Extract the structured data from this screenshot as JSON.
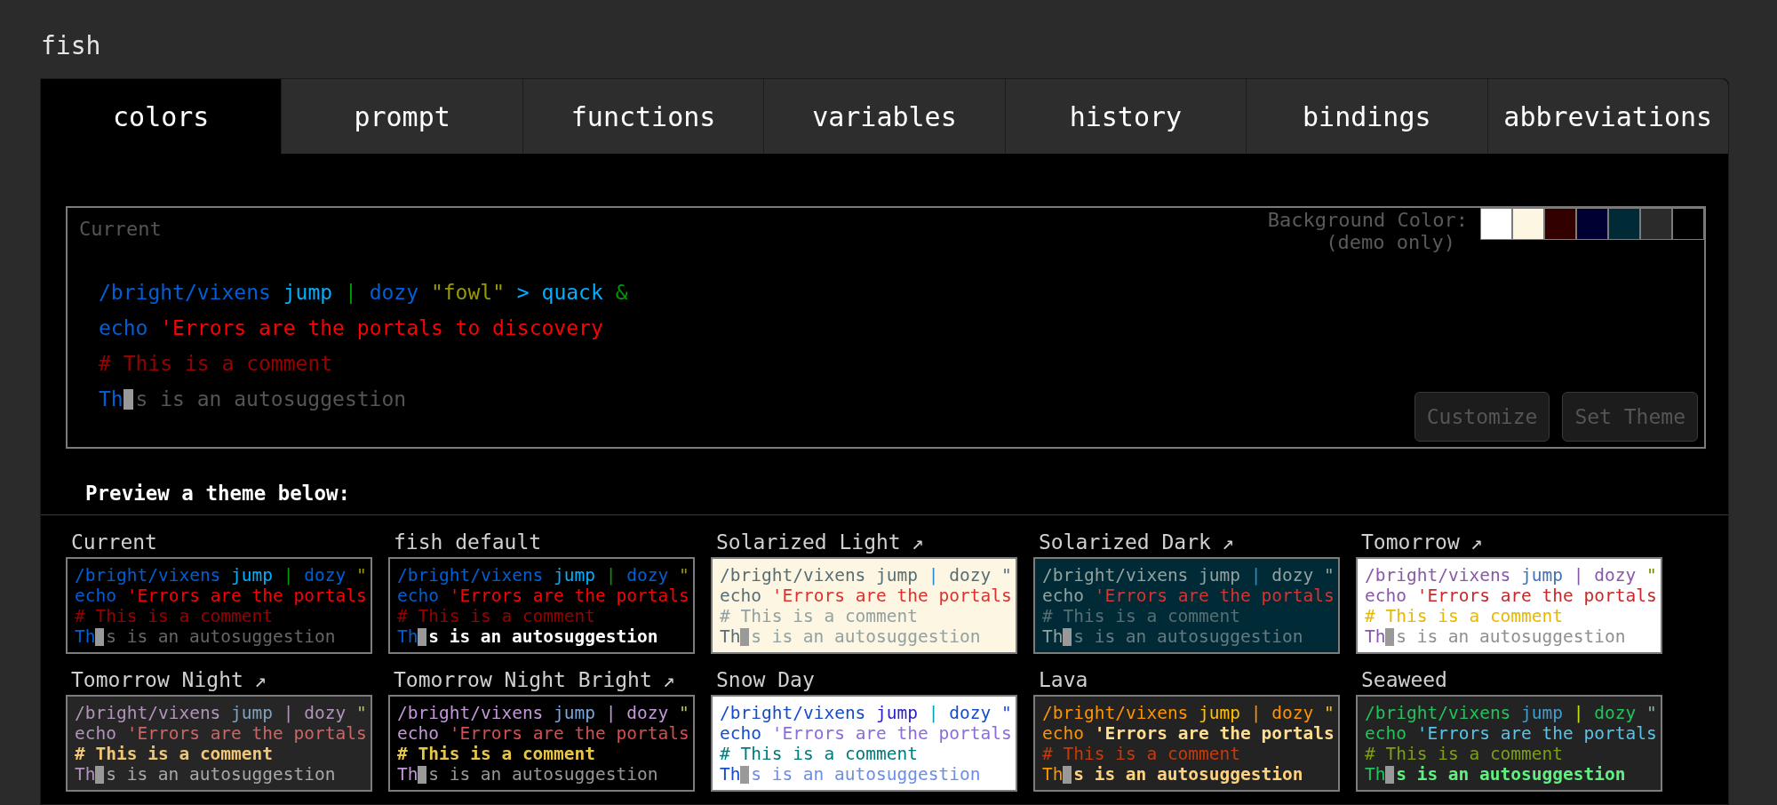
{
  "app": {
    "title": "fish"
  },
  "tabs": [
    {
      "label": "colors",
      "selected": true
    },
    {
      "label": "prompt",
      "selected": false
    },
    {
      "label": "functions",
      "selected": false
    },
    {
      "label": "variables",
      "selected": false
    },
    {
      "label": "history",
      "selected": false
    },
    {
      "label": "bindings",
      "selected": false
    },
    {
      "label": "abbreviations",
      "selected": false
    }
  ],
  "current_preview": {
    "label": "Current",
    "background_picker": {
      "label": "Background Color:",
      "note": "(demo only)",
      "swatches": [
        {
          "color": "#ffffff"
        },
        {
          "color": "#fdf6e3"
        },
        {
          "color": "#330000"
        },
        {
          "color": "#000033"
        },
        {
          "color": "#002b36"
        },
        {
          "color": "#2b2b2b"
        },
        {
          "color": "#000000"
        }
      ]
    },
    "lines": [
      [
        {
          "kind": "plain",
          "text": "/bright/vixens",
          "color": "#005fd7"
        },
        {
          "kind": "plain",
          "text": " jump",
          "color": "#00afff"
        },
        {
          "kind": "plain",
          "text": " |",
          "color": "#009900"
        },
        {
          "kind": "plain",
          "text": " dozy",
          "color": "#005fd7"
        },
        {
          "kind": "plain",
          "text": " \"fowl\"",
          "color": "#999900"
        },
        {
          "kind": "plain",
          "text": " >",
          "color": "#00afff"
        },
        {
          "kind": "plain",
          "text": " quack",
          "color": "#00afff"
        },
        {
          "kind": "plain",
          "text": " &",
          "color": "#009900"
        }
      ],
      [
        {
          "kind": "plain",
          "text": "echo",
          "color": "#005fd7"
        },
        {
          "kind": "plain",
          "text": " 'Errors are the portals to discovery",
          "color": "#ff0000"
        }
      ],
      [
        {
          "kind": "plain",
          "text": "# This is a comment",
          "color": "#990000"
        }
      ],
      [
        {
          "kind": "plain",
          "text": "Th",
          "color": "#005fd7"
        },
        {
          "kind": "cursor"
        },
        {
          "kind": "plain",
          "text": "s is an autosuggestion",
          "color": "#555555"
        }
      ]
    ],
    "buttons": [
      {
        "label": "Customize",
        "disabled": true
      },
      {
        "label": "Set Theme",
        "disabled": true
      }
    ]
  },
  "themes_heading": "Preview a theme below:",
  "themes": [
    {
      "name": "Current",
      "color": "#000000",
      "lines": [
        [
          {
            "kind": "plain",
            "text": "/bright/vixens",
            "color": "#005fd7"
          },
          {
            "kind": "plain",
            "text": " jump",
            "color": "#00afff"
          },
          {
            "kind": "plain",
            "text": " |",
            "color": "#009900"
          },
          {
            "kind": "plain",
            "text": " dozy",
            "color": "#005fd7"
          },
          {
            "kind": "plain",
            "text": " \"",
            "color": "#999900"
          }
        ],
        [
          {
            "kind": "plain",
            "text": "echo",
            "color": "#005fd7"
          },
          {
            "kind": "plain",
            "text": " 'Errors are the portals",
            "color": "#ff0000"
          }
        ],
        [
          {
            "kind": "plain",
            "text": "# This is a comment",
            "color": "#990000"
          }
        ],
        [
          {
            "kind": "plain",
            "text": "Th",
            "color": "#005fd7"
          },
          {
            "kind": "cursor"
          },
          {
            "kind": "plain",
            "text": "s is an autosuggestion",
            "color": "#666666"
          }
        ]
      ]
    },
    {
      "name": "fish default",
      "color": "#000000",
      "lines": [
        [
          {
            "kind": "plain",
            "text": "/bright/vixens",
            "color": "#005fd7"
          },
          {
            "kind": "plain",
            "text": " jump",
            "color": "#00afff"
          },
          {
            "kind": "plain",
            "text": " |",
            "color": "#009900"
          },
          {
            "kind": "plain",
            "text": " dozy",
            "color": "#005fd7"
          },
          {
            "kind": "plain",
            "text": " \"",
            "color": "#999900"
          }
        ],
        [
          {
            "kind": "plain",
            "text": "echo",
            "color": "#005fd7"
          },
          {
            "kind": "plain",
            "text": " 'Errors are the portals",
            "color": "#ff0000"
          }
        ],
        [
          {
            "kind": "plain",
            "text": "# This is a comment",
            "color": "#990000"
          }
        ],
        [
          {
            "kind": "plain",
            "text": "Th",
            "color": "#005fd7"
          },
          {
            "kind": "cursor"
          },
          {
            "kind": "bold",
            "text": "s is an autosuggestion",
            "color": "#ffffff"
          }
        ]
      ]
    },
    {
      "name": "Solarized Light",
      "link": "↗",
      "color": "#fdf6e3",
      "lines": [
        [
          {
            "kind": "plain",
            "text": "/bright/vixens",
            "color": "#586e75"
          },
          {
            "kind": "plain",
            "text": " jump",
            "color": "#586e75"
          },
          {
            "kind": "plain",
            "text": " |",
            "color": "#268bd2"
          },
          {
            "kind": "plain",
            "text": " dozy",
            "color": "#586e75"
          },
          {
            "kind": "plain",
            "text": " \"",
            "color": "#586e75"
          }
        ],
        [
          {
            "kind": "plain",
            "text": "echo",
            "color": "#586e75"
          },
          {
            "kind": "plain",
            "text": " 'Errors are the portals",
            "color": "#dc322f"
          }
        ],
        [
          {
            "kind": "plain",
            "text": "# This is a comment",
            "color": "#93a1a1"
          }
        ],
        [
          {
            "kind": "plain",
            "text": "Th",
            "color": "#586e75"
          },
          {
            "kind": "cursor"
          },
          {
            "kind": "plain",
            "text": "s is an autosuggestion",
            "color": "#93a1a1"
          }
        ]
      ]
    },
    {
      "name": "Solarized Dark",
      "link": "↗",
      "color": "#002b36",
      "lines": [
        [
          {
            "kind": "plain",
            "text": "/bright/vixens",
            "color": "#93a1a1"
          },
          {
            "kind": "plain",
            "text": " jump",
            "color": "#93a1a1"
          },
          {
            "kind": "plain",
            "text": " |",
            "color": "#268bd2"
          },
          {
            "kind": "plain",
            "text": " dozy",
            "color": "#93a1a1"
          },
          {
            "kind": "plain",
            "text": " \"",
            "color": "#93a1a1"
          }
        ],
        [
          {
            "kind": "plain",
            "text": "echo",
            "color": "#93a1a1"
          },
          {
            "kind": "plain",
            "text": " 'Errors are the portals",
            "color": "#dc322f"
          }
        ],
        [
          {
            "kind": "plain",
            "text": "# This is a comment",
            "color": "#586e75"
          }
        ],
        [
          {
            "kind": "plain",
            "text": "Th",
            "color": "#93a1a1"
          },
          {
            "kind": "cursor"
          },
          {
            "kind": "plain",
            "text": "s is an autosuggestion",
            "color": "#657b83"
          }
        ]
      ]
    },
    {
      "name": "Tomorrow",
      "link": "↗",
      "color": "#ffffff",
      "lines": [
        [
          {
            "kind": "plain",
            "text": "/bright/vixens",
            "color": "#8959a8"
          },
          {
            "kind": "plain",
            "text": " jump",
            "color": "#4271ae"
          },
          {
            "kind": "plain",
            "text": " |",
            "color": "#8959a8"
          },
          {
            "kind": "plain",
            "text": " dozy",
            "color": "#8959a8"
          },
          {
            "kind": "plain",
            "text": " \"",
            "color": "#718c00"
          }
        ],
        [
          {
            "kind": "plain",
            "text": "echo",
            "color": "#8959a8"
          },
          {
            "kind": "plain",
            "text": " 'Errors are the portals",
            "color": "#c82829"
          }
        ],
        [
          {
            "kind": "plain",
            "text": "# This is a comment",
            "color": "#eab700"
          }
        ],
        [
          {
            "kind": "plain",
            "text": "Th",
            "color": "#8959a8"
          },
          {
            "kind": "cursor"
          },
          {
            "kind": "plain",
            "text": "s is an autosuggestion",
            "color": "#8e908c"
          }
        ]
      ]
    },
    {
      "name": "Tomorrow Night",
      "link": "↗",
      "color": "#262626",
      "lines": [
        [
          {
            "kind": "plain",
            "text": "/bright/vixens",
            "color": "#b294bb"
          },
          {
            "kind": "plain",
            "text": " jump",
            "color": "#81a2be"
          },
          {
            "kind": "plain",
            "text": " |",
            "color": "#b294bb"
          },
          {
            "kind": "plain",
            "text": " dozy",
            "color": "#b294bb"
          },
          {
            "kind": "plain",
            "text": " \"",
            "color": "#b5bd68"
          }
        ],
        [
          {
            "kind": "plain",
            "text": "echo",
            "color": "#b294bb"
          },
          {
            "kind": "plain",
            "text": " 'Errors are the portals",
            "color": "#cc6666"
          }
        ],
        [
          {
            "kind": "bold",
            "text": "# This is a comment",
            "color": "#f0c674"
          }
        ],
        [
          {
            "kind": "plain",
            "text": "Th",
            "color": "#b294bb"
          },
          {
            "kind": "cursor"
          },
          {
            "kind": "plain",
            "text": "s is an autosuggestion",
            "color": "#a8a8a8"
          }
        ]
      ]
    },
    {
      "name": "Tomorrow Night Bright",
      "link": "↗",
      "color": "#000000",
      "lines": [
        [
          {
            "kind": "plain",
            "text": "/bright/vixens",
            "color": "#c397d8"
          },
          {
            "kind": "plain",
            "text": " jump",
            "color": "#7aa6da"
          },
          {
            "kind": "plain",
            "text": " |",
            "color": "#c397d8"
          },
          {
            "kind": "plain",
            "text": " dozy",
            "color": "#c397d8"
          },
          {
            "kind": "plain",
            "text": " \"",
            "color": "#b9ca4a"
          }
        ],
        [
          {
            "kind": "plain",
            "text": "echo",
            "color": "#c397d8"
          },
          {
            "kind": "plain",
            "text": " 'Errors are the portals",
            "color": "#d54e53"
          }
        ],
        [
          {
            "kind": "bold",
            "text": "# This is a comment",
            "color": "#e7c547"
          }
        ],
        [
          {
            "kind": "plain",
            "text": "Th",
            "color": "#c397d8"
          },
          {
            "kind": "cursor"
          },
          {
            "kind": "plain",
            "text": "s is an autosuggestion",
            "color": "#969896"
          }
        ]
      ]
    },
    {
      "name": "Snow Day",
      "color": "#ffffff",
      "lines": [
        [
          {
            "kind": "plain",
            "text": "/bright/vixens",
            "color": "#164cc9"
          },
          {
            "kind": "plain",
            "text": " jump",
            "color": "#2a20c8"
          },
          {
            "kind": "plain",
            "text": " |",
            "color": "#00a6b2"
          },
          {
            "kind": "plain",
            "text": " dozy",
            "color": "#164cc9"
          },
          {
            "kind": "plain",
            "text": " \"",
            "color": "#164cc9"
          }
        ],
        [
          {
            "kind": "plain",
            "text": "echo",
            "color": "#164cc9"
          },
          {
            "kind": "plain",
            "text": " 'Errors are the portals",
            "color": "#8a6dd8"
          }
        ],
        [
          {
            "kind": "plain",
            "text": "# This is a comment",
            "color": "#007b7b"
          }
        ],
        [
          {
            "kind": "plain",
            "text": "Th",
            "color": "#164cc9"
          },
          {
            "kind": "cursor"
          },
          {
            "kind": "plain",
            "text": "s is an autosuggestion",
            "color": "#6d8ee3"
          }
        ]
      ]
    },
    {
      "name": "Lava",
      "color": "#232323",
      "lines": [
        [
          {
            "kind": "plain",
            "text": "/bright/vixens",
            "color": "#ff9400"
          },
          {
            "kind": "plain",
            "text": " jump",
            "color": "#ffc000"
          },
          {
            "kind": "plain",
            "text": " |",
            "color": "#ff9400"
          },
          {
            "kind": "plain",
            "text": " dozy",
            "color": "#ff9400"
          },
          {
            "kind": "plain",
            "text": " \"",
            "color": "#ffc000"
          }
        ],
        [
          {
            "kind": "plain",
            "text": "echo",
            "color": "#ff9400"
          },
          {
            "kind": "bold",
            "text": " 'Errors are the portals",
            "color": "#ffdf8f"
          }
        ],
        [
          {
            "kind": "plain",
            "text": "# This is a comment",
            "color": "#c83a0a"
          }
        ],
        [
          {
            "kind": "plain",
            "text": "Th",
            "color": "#ff9400"
          },
          {
            "kind": "cursor"
          },
          {
            "kind": "bold",
            "text": "s is an autosuggestion",
            "color": "#ffd27f"
          }
        ]
      ]
    },
    {
      "name": "Seaweed",
      "color": "#232323",
      "lines": [
        [
          {
            "kind": "plain",
            "text": "/bright/vixens",
            "color": "#21c45a"
          },
          {
            "kind": "plain",
            "text": " jump",
            "color": "#3d9fd1"
          },
          {
            "kind": "plain",
            "text": " |",
            "color": "#c5e000"
          },
          {
            "kind": "plain",
            "text": " dozy",
            "color": "#21c45a"
          },
          {
            "kind": "plain",
            "text": " \"",
            "color": "#8fb3a5"
          }
        ],
        [
          {
            "kind": "plain",
            "text": "echo",
            "color": "#21c45a"
          },
          {
            "kind": "plain",
            "text": " 'Errors are the portals",
            "color": "#5bc3e6"
          }
        ],
        [
          {
            "kind": "plain",
            "text": "# This is a comment",
            "color": "#7d9e16"
          }
        ],
        [
          {
            "kind": "plain",
            "text": "Th",
            "color": "#21c45a"
          },
          {
            "kind": "cursor"
          },
          {
            "kind": "bold",
            "text": "s is an autosuggestion",
            "color": "#5ff07f"
          }
        ]
      ]
    }
  ]
}
